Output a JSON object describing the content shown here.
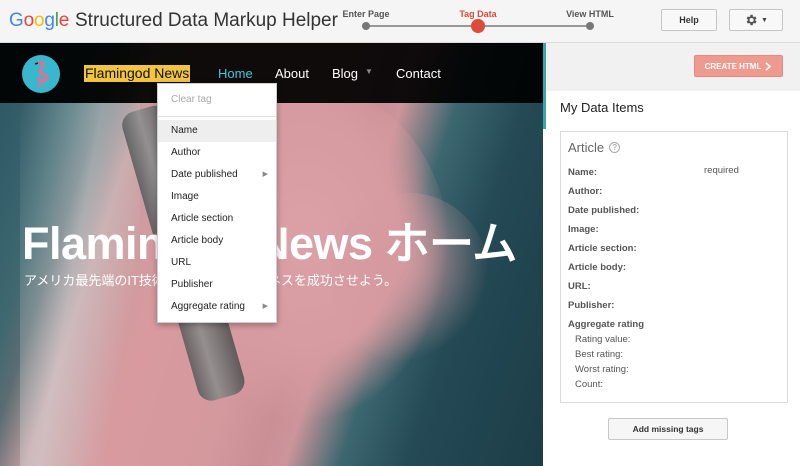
{
  "app": {
    "logo_letters": [
      "G",
      "o",
      "o",
      "g",
      "l",
      "e"
    ],
    "title": "Structured Data Markup Helper"
  },
  "stepper": {
    "steps": [
      {
        "label": "Enter Page",
        "active": false
      },
      {
        "label": "Tag Data",
        "active": true
      },
      {
        "label": "View HTML",
        "active": false
      }
    ]
  },
  "toolbar": {
    "help_label": "Help",
    "settings_icon": "gear-icon"
  },
  "site": {
    "name": "Flamingod News",
    "nav": [
      {
        "label": "Home",
        "active": true
      },
      {
        "label": "About",
        "active": false
      },
      {
        "label": "Blog",
        "active": false,
        "has_dropdown": true
      },
      {
        "label": "Contact",
        "active": false
      }
    ],
    "hero_title": "Flamingod News ホーム",
    "hero_subtitle": "アメリカ最先端のIT技術を駆使して、ビジネスを成功させよう。"
  },
  "tag_menu": {
    "clear_label": "Clear tag",
    "items": [
      {
        "label": "Name",
        "highlighted": true,
        "submenu": false
      },
      {
        "label": "Author",
        "highlighted": false,
        "submenu": false
      },
      {
        "label": "Date published",
        "highlighted": false,
        "submenu": true
      },
      {
        "label": "Image",
        "highlighted": false,
        "submenu": false
      },
      {
        "label": "Article section",
        "highlighted": false,
        "submenu": false
      },
      {
        "label": "Article body",
        "highlighted": false,
        "submenu": false
      },
      {
        "label": "URL",
        "highlighted": false,
        "submenu": false
      },
      {
        "label": "Publisher",
        "highlighted": false,
        "submenu": false
      },
      {
        "label": "Aggregate rating",
        "highlighted": false,
        "submenu": true
      }
    ]
  },
  "panel": {
    "create_html_label": "CREATE HTML",
    "title": "My Data Items",
    "article_label": "Article",
    "required_label": "required",
    "fields": [
      "Name:",
      "Author:",
      "Date published:",
      "Image:",
      "Article section:",
      "Article body:",
      "URL:",
      "Publisher:"
    ],
    "rating_label": "Aggregate rating",
    "rating_fields": [
      "Rating value:",
      "Best rating:",
      "Worst rating:",
      "Count:"
    ],
    "add_missing_label": "Add missing tags"
  },
  "colors": {
    "accent": "#dd4b39",
    "create_button": "#ef9a8f",
    "site_highlight": "#f2c440",
    "nav_active": "#3ec7e0",
    "logo_circle": "#39b7cf"
  }
}
